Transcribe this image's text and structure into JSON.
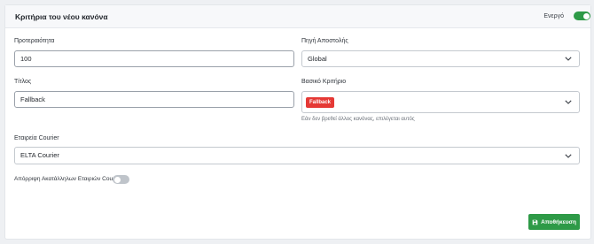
{
  "header": {
    "title": "Κριτήρια του νέου κανόνα",
    "active_label": "Ενεργό",
    "active_on": true
  },
  "fields": {
    "priority": {
      "label": "Προτεραιότητα",
      "value": "100"
    },
    "source": {
      "label": "Πηγή Αποστολής",
      "value": "Global"
    },
    "title": {
      "label": "Τίτλος",
      "value": "Fallback"
    },
    "base_criterion": {
      "label": "Βασικό Κριτήριο",
      "badge": "Fallback",
      "hint": "Εάν δεν βρεθεί άλλος κανόνας, επιλέγεται αυτός"
    },
    "courier": {
      "label": "Εταιρεία Courier",
      "value": "ELTA Courier"
    },
    "exclude_incompatible": {
      "label": "Απόρριψη Ακατάλληλων Εταιριών Courier",
      "on": false
    }
  },
  "footer": {
    "save_label": "Αποθήκευση",
    "save_icon": "floppy-disk-icon"
  },
  "colors": {
    "accent_green": "#2e9a47",
    "badge_red": "#e53935"
  }
}
